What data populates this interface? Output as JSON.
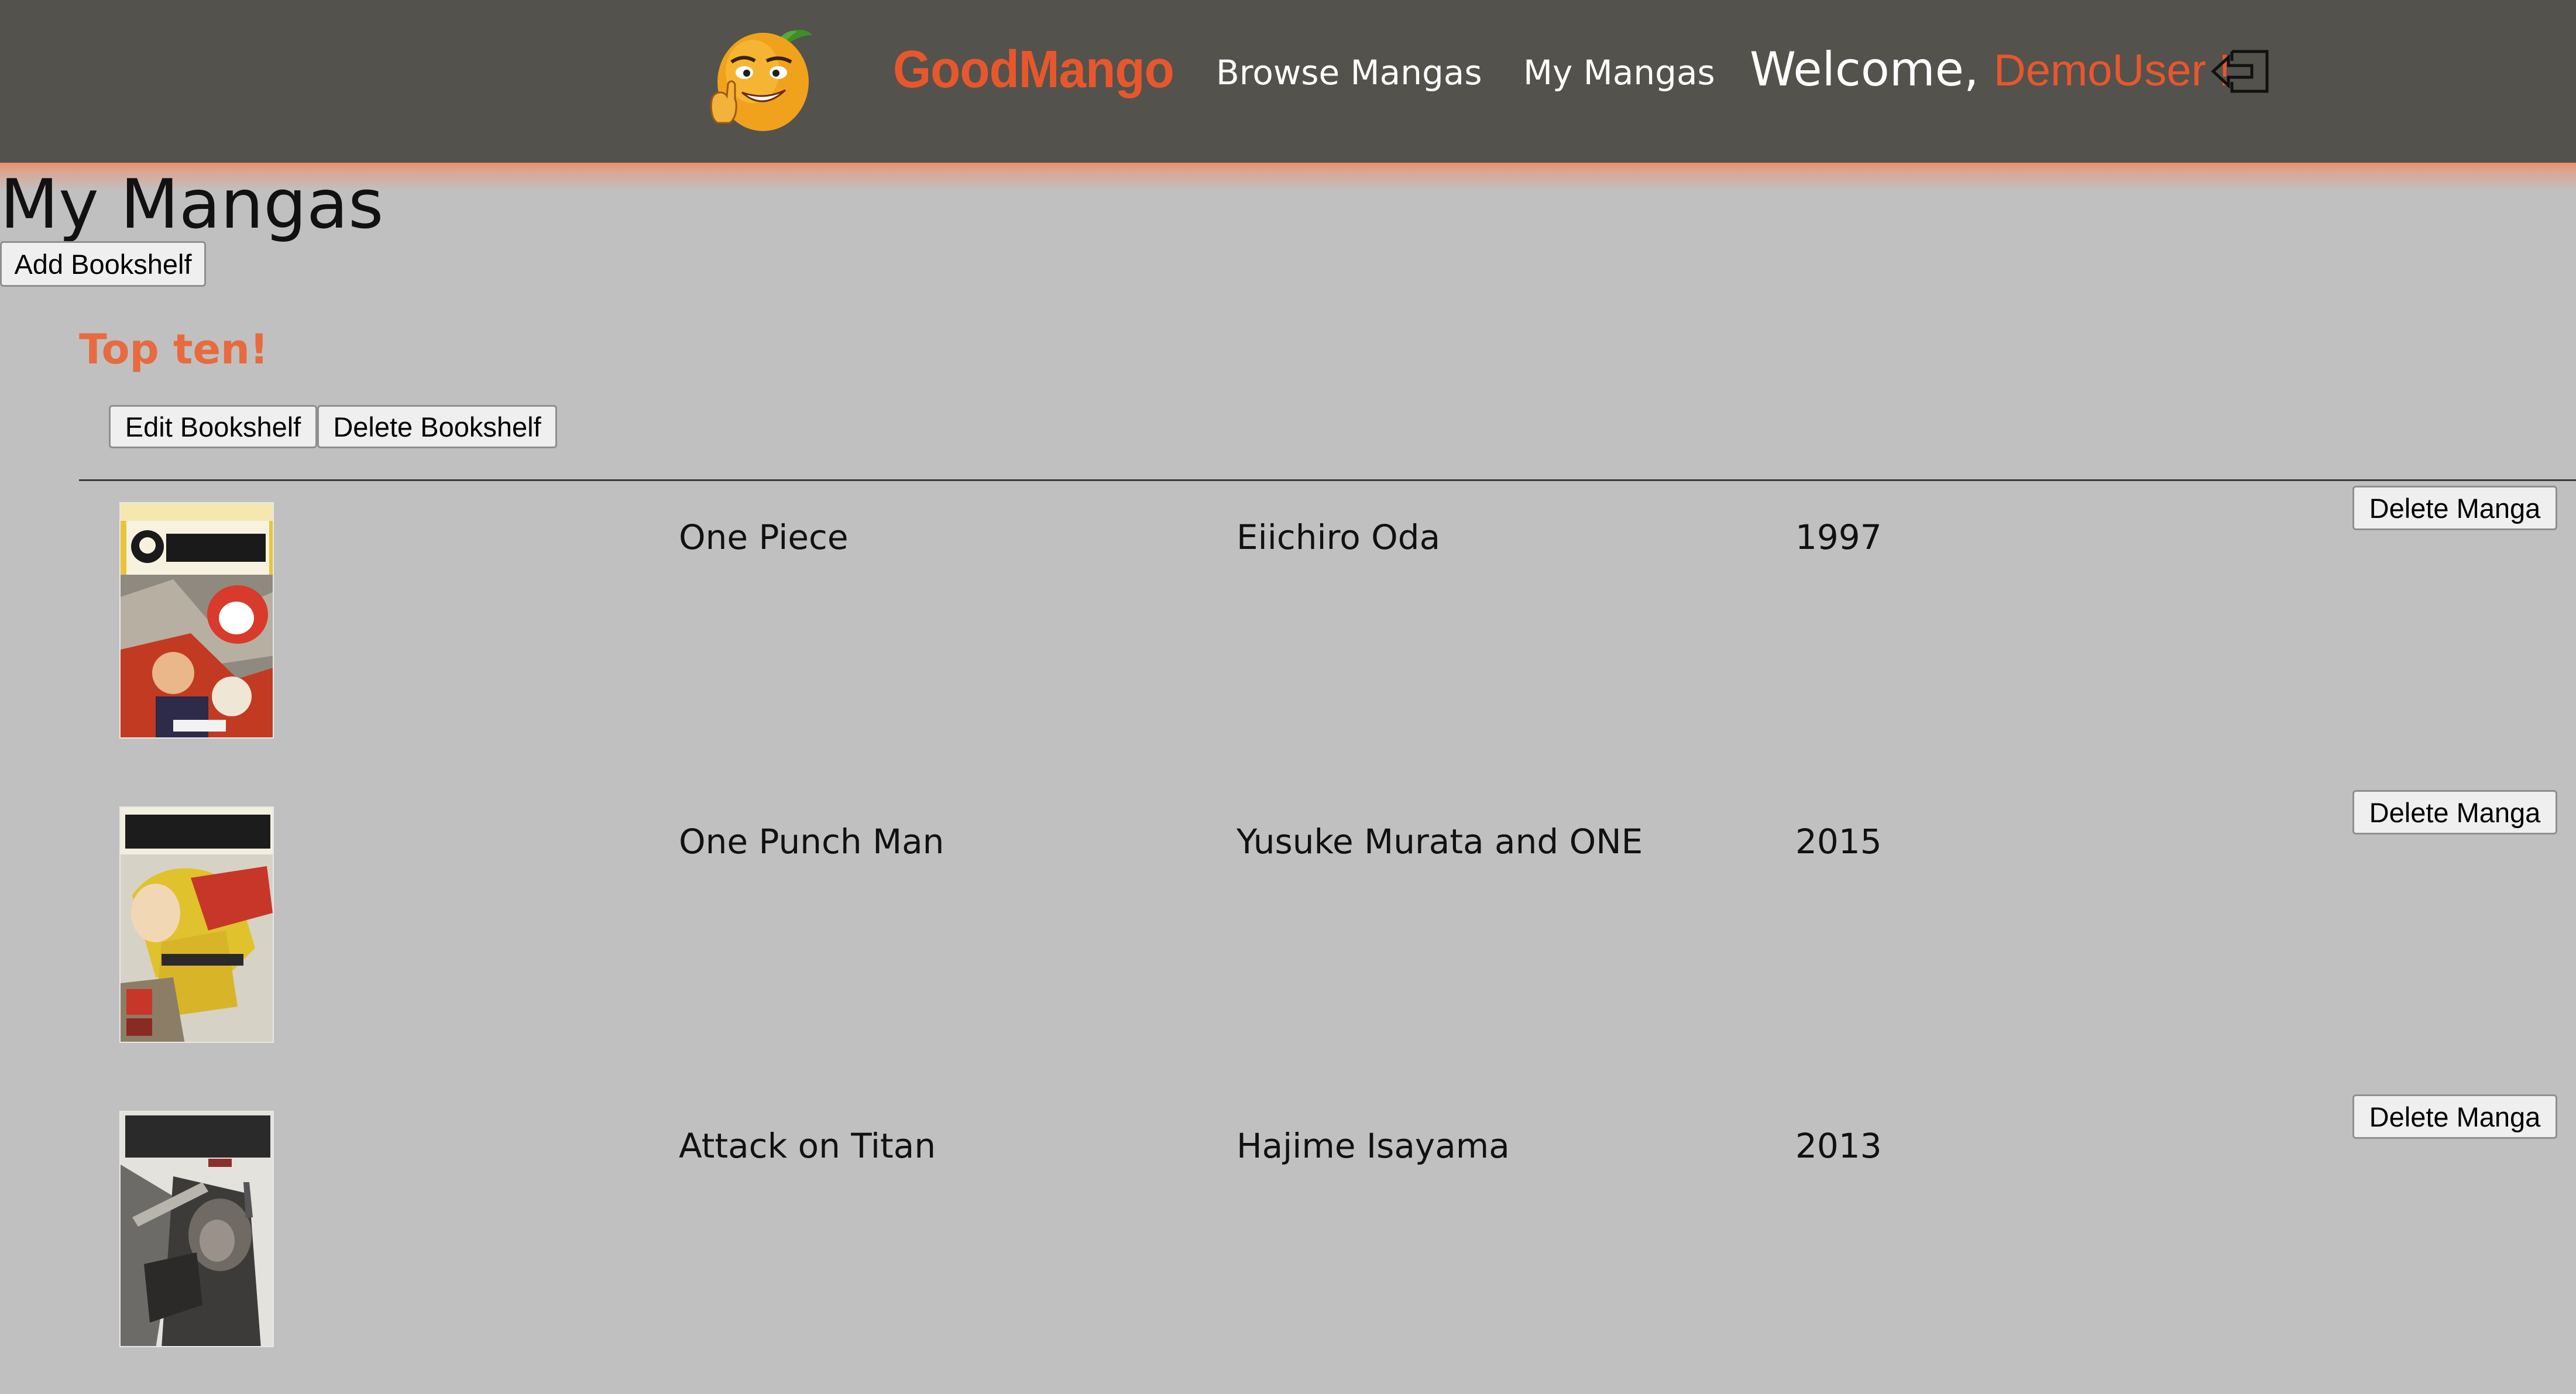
{
  "nav": {
    "brand": "GoodMango",
    "links": [
      "Browse Mangas",
      "My Mangas"
    ],
    "welcome_prefix": "Welcome,",
    "username": "DemoUser !"
  },
  "page": {
    "title": "My Mangas",
    "add_bookshelf_label": "Add Bookshelf"
  },
  "bookshelf": {
    "name": "Top ten!",
    "edit_label": "Edit Bookshelf",
    "delete_label": "Delete Bookshelf",
    "mangas": [
      {
        "title": "One Piece",
        "author": "Eiichiro Oda",
        "year": "1997",
        "delete_label": "Delete Manga"
      },
      {
        "title": "One Punch Man",
        "author": "Yusuke Murata and ONE",
        "year": "2015",
        "delete_label": "Delete Manga"
      },
      {
        "title": "Attack on Titan",
        "author": "Hajime Isayama",
        "year": "2013",
        "delete_label": "Delete Manga"
      }
    ]
  },
  "colors": {
    "navbar_bg": "#53524d",
    "accent": "#e8572c",
    "shelf_title": "#e76b3e",
    "page_bg": "#c0c0c0"
  },
  "icons": {
    "logo": "mango-mascot-logo",
    "logout": "logout-icon"
  }
}
